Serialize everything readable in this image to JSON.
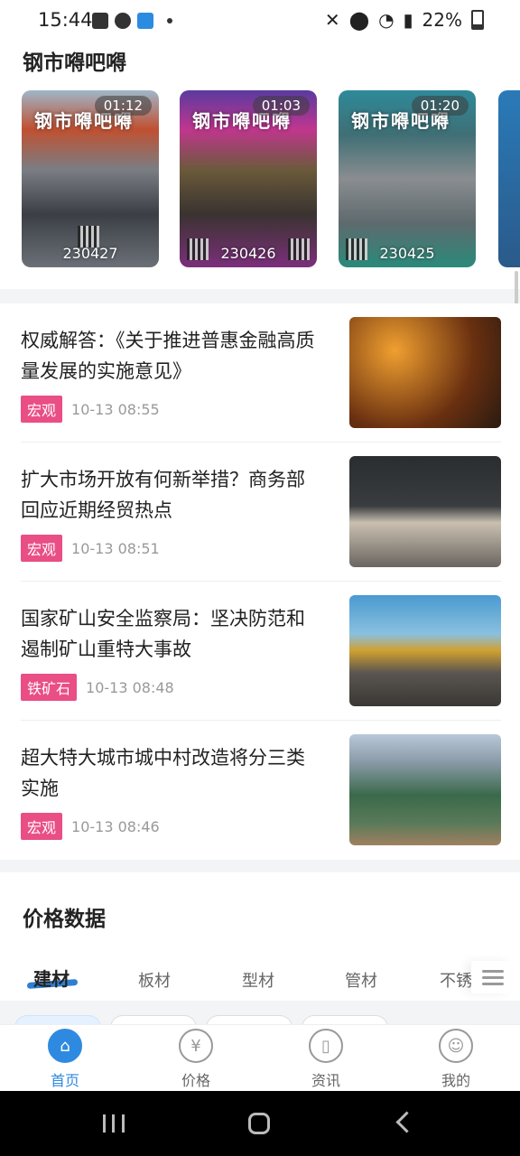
{
  "status_bar": {
    "time": "15:44",
    "battery": "22%",
    "left_icons": [
      "gallery-icon",
      "cloud-icon",
      "snowflake-icon"
    ],
    "right_icons": [
      "mute-icon",
      "location-icon",
      "wifi-icon",
      "signal-icon",
      "battery-icon"
    ]
  },
  "video_section": {
    "title": "钢市嘚吧嘚",
    "cards": [
      {
        "duration": "01:12",
        "date": "230427",
        "banner": "钢市嘚吧嘚"
      },
      {
        "duration": "01:03",
        "date": "230426",
        "banner": "钢市嘚吧嘚"
      },
      {
        "duration": "01:20",
        "date": "230425",
        "banner": "钢市嘚吧嘚"
      }
    ]
  },
  "news": [
    {
      "title": "权威解答：《关于推进普惠金融高质量发展的实施意见》",
      "tag": "宏观",
      "time": "10-13 08:55"
    },
    {
      "title": "扩大市场开放有何新举措？商务部回应近期经贸热点",
      "tag": "宏观",
      "time": "10-13 08:51"
    },
    {
      "title": "国家矿山安全监察局：坚决防范和遏制矿山重特大事故",
      "tag": "铁矿石",
      "time": "10-13 08:48"
    },
    {
      "title": "超大特大城市城中村改造将分三类实施",
      "tag": "宏观",
      "time": "10-13 08:46"
    }
  ],
  "price_section": {
    "title": "价格数据",
    "tabs": [
      "建材",
      "板材",
      "型材",
      "管材",
      "不锈"
    ]
  },
  "bottom_nav": [
    {
      "label": "首页",
      "icon": "home-icon"
    },
    {
      "label": "价格",
      "icon": "yen-icon"
    },
    {
      "label": "资讯",
      "icon": "book-icon"
    },
    {
      "label": "我的",
      "icon": "user-icon"
    }
  ],
  "colors": {
    "accent": "#2e8ae0",
    "tag": "#e94e84"
  }
}
